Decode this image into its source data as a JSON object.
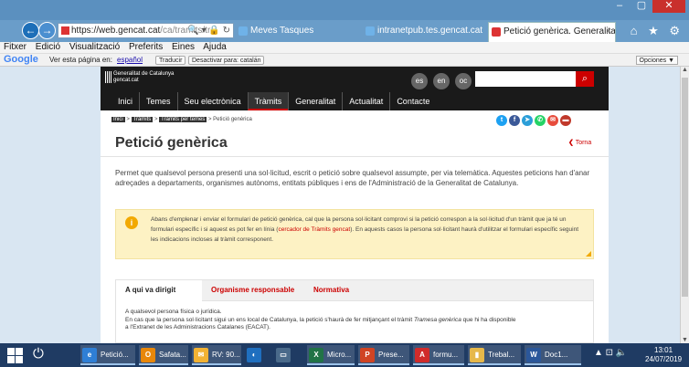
{
  "browser": {
    "back_label": "←",
    "forward_label": "→",
    "address_url": "https://web.gencat.cat",
    "address_url_tail": "/ca/tramits/tr",
    "address_icons": "🔍 ▾ 🔒 ↻",
    "tabs": [
      {
        "label": "Meves Tasques",
        "active": false
      },
      {
        "label": "intranetpub.tes.gencat.cat",
        "active": false
      },
      {
        "label": "Petició genèrica. Generalitat d...",
        "active": true
      }
    ],
    "tab_close": "×",
    "window_min": "–",
    "window_max": "▢",
    "window_close": "✕",
    "toolbar_icons": "⌂ ★ ⚙"
  },
  "menubar": [
    "Fitxer",
    "Edició",
    "Visualització",
    "Preferits",
    "Eines",
    "Ajuda"
  ],
  "translate_bar": {
    "logo": "Google",
    "text_prefix": "Ver esta página en:",
    "language": "español",
    "translate_button": "Traducir",
    "disable_button": "Desactivar para: catalán",
    "options_button": "Opciones ▼"
  },
  "site": {
    "logo_line1": "Generalitat de Catalunya",
    "logo_line2": "gencat.cat",
    "langs": [
      "es",
      "en",
      "oc"
    ],
    "search_icon": "search-icon",
    "nav": [
      "Inici",
      "Temes",
      "Seu electrònica",
      "Tràmits",
      "Generalitat",
      "Actualitat",
      "Contacte"
    ],
    "nav_active": "Tràmits"
  },
  "breadcrumb": {
    "items": [
      "Inici",
      "Tràmits",
      "Tràmits per temes"
    ],
    "current": "Petició genèrica",
    "separator": ">"
  },
  "social_icons": [
    {
      "name": "twitter-icon",
      "glyph": "t",
      "color": "#1da1f2"
    },
    {
      "name": "facebook-icon",
      "glyph": "f",
      "color": "#3b5998"
    },
    {
      "name": "telegram-icon",
      "glyph": "➤",
      "color": "#2b9ed8"
    },
    {
      "name": "whatsapp-icon",
      "glyph": "✆",
      "color": "#25d366"
    },
    {
      "name": "email-icon",
      "glyph": "✉",
      "color": "#e74c3c"
    },
    {
      "name": "share-icon",
      "glyph": "▬",
      "color": "#c0392b"
    }
  ],
  "page": {
    "title": "Petició genèrica",
    "back_link": "Torna",
    "intro": "Permet que qualsevol persona presenti una sol·licitud, escrit o petició sobre qualsevol assumpte, per via telemàtica. Aquestes peticions han d'anar adreçades a departaments, organismes autònoms, entitats públiques i ens de l'Administració de la Generalitat de Catalunya."
  },
  "alert": {
    "icon": "i",
    "text_before": "Abans d'emplenar i enviar el formulari de petició genèrica, cal que la persona sol·licitant comprovi si la petició correspon a la sol·licitud d'un tràmit que ja té un formulari específic i si aquest es pot fer en línia (",
    "link": "cercador de Tràmits gencat",
    "text_after": "). En aquests casos la persona sol·licitant haurà d'utilitzar el formulari específic seguint les indicacions incloses al tràmit corresponent."
  },
  "content_tabs": {
    "tabs": [
      "A qui va dirigit",
      "Organisme responsable",
      "Normativa"
    ],
    "active": "A qui va dirigit",
    "line1": "A qualsevol persona física o jurídica.",
    "line2_before": "En cas que la persona sol·licitant sigui un ens local de Catalunya, la petició s'haurà de fer mitjançant el tràmit ",
    "line2_italic": "Tramesa genèrica",
    "line2_after": " que hi ha disponible",
    "line3": "a l'Extranet de les Administracions Catalanes (EACAT)."
  },
  "taskbar": {
    "items": [
      {
        "label": "Petició...",
        "icon": "ie-icon",
        "glyph": "e",
        "color": "#2f7fd6",
        "open": true
      },
      {
        "label": "Safata...",
        "icon": "outlook-icon",
        "glyph": "O",
        "color": "#e8870a",
        "open": true
      },
      {
        "label": "RV: 90...",
        "icon": "mail-icon",
        "glyph": "✉",
        "color": "#f2b233",
        "open": true
      },
      {
        "label": "",
        "icon": "lync-icon",
        "glyph": "◐",
        "color": "#1f6fbf",
        "open": false
      },
      {
        "label": "",
        "icon": "desktop-icon",
        "glyph": "▭",
        "color": "#4a6a8a",
        "open": false
      },
      {
        "label": "Micro...",
        "icon": "excel-icon",
        "glyph": "X",
        "color": "#217346",
        "open": true
      },
      {
        "label": "Prese...",
        "icon": "powerpoint-icon",
        "glyph": "P",
        "color": "#d04423",
        "open": true
      },
      {
        "label": "formu...",
        "icon": "pdf-icon",
        "glyph": "A",
        "color": "#d02b2b",
        "open": true
      },
      {
        "label": "Trebal...",
        "icon": "folder-icon",
        "glyph": "▮",
        "color": "#e6b84a",
        "open": true
      },
      {
        "label": "Doc1...",
        "icon": "word-icon",
        "glyph": "W",
        "color": "#2b579a",
        "open": true
      }
    ],
    "tray_icons": "▲ ⊡ 🔈",
    "time": "13:01",
    "date": "24/07/2019"
  }
}
